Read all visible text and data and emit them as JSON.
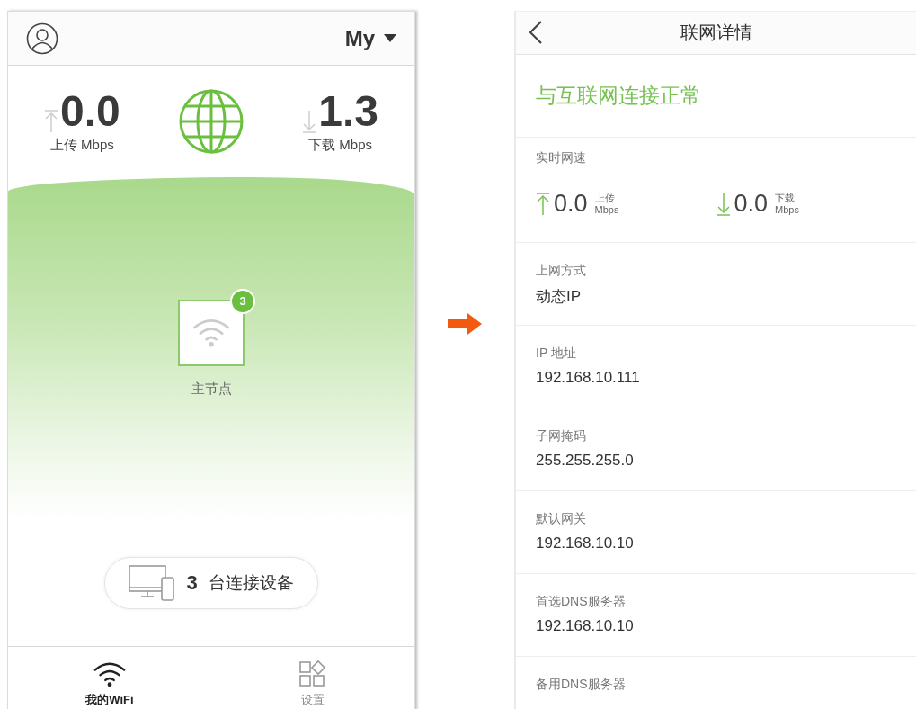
{
  "left_screen": {
    "header": {
      "network_name": "My"
    },
    "upload": {
      "value": "0.0",
      "label": "上传 Mbps"
    },
    "download": {
      "value": "1.3",
      "label": "下载 Mbps"
    },
    "node": {
      "label": "主节点",
      "badge": "3"
    },
    "devices": {
      "count": "3",
      "label": "台连接设备"
    },
    "tabs": [
      {
        "kind": "wifi",
        "label": "我的WiFi",
        "selected": true
      },
      {
        "kind": "apps",
        "label": "设置",
        "selected": false
      }
    ]
  },
  "right_screen": {
    "title": "联网详情",
    "status": "与互联网连接正常",
    "speed": {
      "label": "实时网速",
      "items": [
        {
          "kind": "upload",
          "value": "0.0",
          "label": "上传",
          "unit": "Mbps"
        },
        {
          "kind": "download",
          "value": "0.0",
          "label": "下载",
          "unit": "Mbps"
        }
      ]
    },
    "fields": [
      {
        "label": "上网方式",
        "value": "动态IP"
      },
      {
        "label": "IP 地址",
        "value": "192.168.10.111"
      },
      {
        "label": "子网掩码",
        "value": "255.255.255.0"
      },
      {
        "label": "默认网关",
        "value": "192.168.10.10"
      },
      {
        "label": "首选DNS服务器",
        "value": "192.168.10.10"
      },
      {
        "label": "备用DNS服务器"
      }
    ]
  }
}
